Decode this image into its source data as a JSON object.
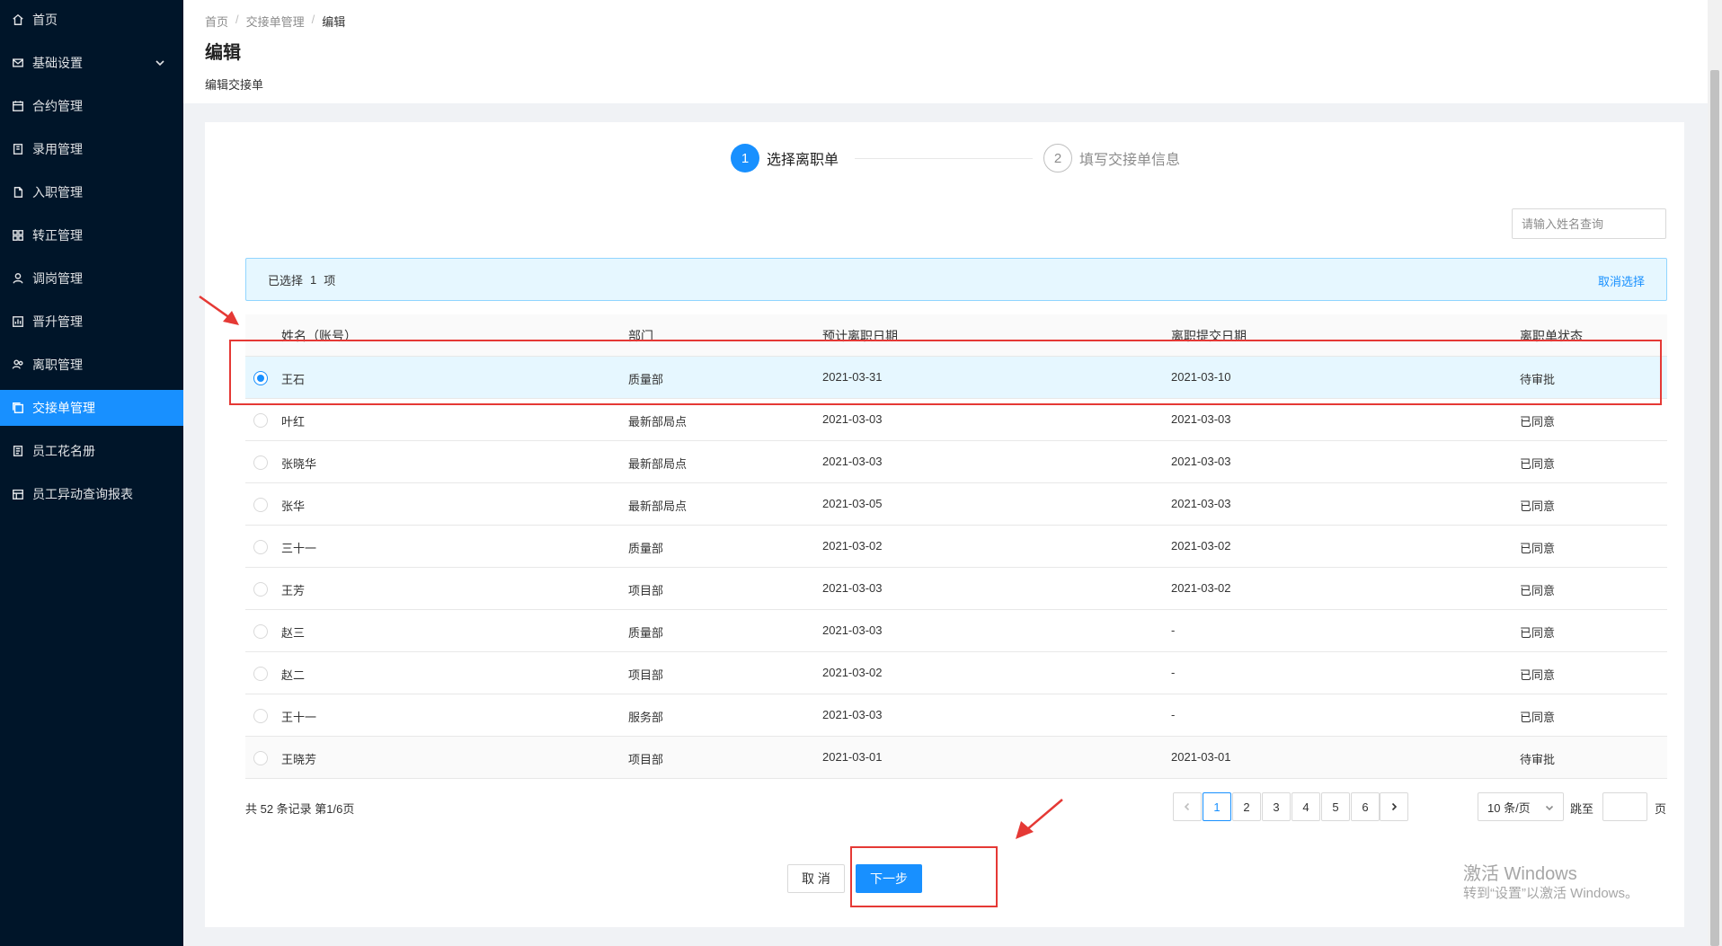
{
  "sidebar": {
    "items": [
      {
        "label": "首页",
        "icon": "home-icon"
      },
      {
        "label": "基础设置",
        "icon": "mail-icon",
        "expandable": true
      },
      {
        "label": "合约管理",
        "icon": "calendar-icon"
      },
      {
        "label": "录用管理",
        "icon": "book-icon"
      },
      {
        "label": "入职管理",
        "icon": "file-icon"
      },
      {
        "label": "转正管理",
        "icon": "grid-icon"
      },
      {
        "label": "调岗管理",
        "icon": "user-icon"
      },
      {
        "label": "晋升管理",
        "icon": "chart-icon"
      },
      {
        "label": "离职管理",
        "icon": "team-icon"
      },
      {
        "label": "交接单管理",
        "icon": "copy-icon",
        "active": true
      },
      {
        "label": "员工花名册",
        "icon": "list-icon"
      },
      {
        "label": "员工异动查询报表",
        "icon": "report-icon"
      }
    ]
  },
  "breadcrumb": {
    "home": "首页",
    "section": "交接单管理",
    "current": "编辑",
    "sep": "/"
  },
  "page": {
    "title": "编辑",
    "subtitle": "编辑交接单"
  },
  "steps": [
    {
      "num": "1",
      "label": "选择离职单",
      "status": "active"
    },
    {
      "num": "2",
      "label": "填写交接单信息",
      "status": "wait"
    }
  ],
  "search": {
    "placeholder": "请输入姓名查询",
    "value": ""
  },
  "alert": {
    "prefix": "已选择",
    "count": "1",
    "suffix": "项",
    "clear": "取消选择"
  },
  "table": {
    "columns": [
      "姓名（账号）",
      "部门",
      "预计离职日期",
      "离职提交日期",
      "离职单状态"
    ],
    "rows": [
      {
        "name": "王石",
        "dept": "质量部",
        "expected": "2021-03-31",
        "submitted": "2021-03-10",
        "status": "待审批",
        "selected": true
      },
      {
        "name": "叶红",
        "dept": "最新部局点",
        "expected": "2021-03-03",
        "submitted": "2021-03-03",
        "status": "已同意",
        "selected": false
      },
      {
        "name": "张晓华",
        "dept": "最新部局点",
        "expected": "2021-03-03",
        "submitted": "2021-03-03",
        "status": "已同意",
        "selected": false
      },
      {
        "name": "张华",
        "dept": "最新部局点",
        "expected": "2021-03-05",
        "submitted": "2021-03-03",
        "status": "已同意",
        "selected": false
      },
      {
        "name": "三十一",
        "dept": "质量部",
        "expected": "2021-03-02",
        "submitted": "2021-03-02",
        "status": "已同意",
        "selected": false
      },
      {
        "name": "王芳",
        "dept": "项目部",
        "expected": "2021-03-03",
        "submitted": "2021-03-02",
        "status": "已同意",
        "selected": false
      },
      {
        "name": "赵三",
        "dept": "质量部",
        "expected": "2021-03-03",
        "submitted": "-",
        "status": "已同意",
        "selected": false
      },
      {
        "name": "赵二",
        "dept": "项目部",
        "expected": "2021-03-02",
        "submitted": "-",
        "status": "已同意",
        "selected": false
      },
      {
        "name": "王十一",
        "dept": "服务部",
        "expected": "2021-03-03",
        "submitted": "-",
        "status": "已同意",
        "selected": false
      },
      {
        "name": "王晓芳",
        "dept": "项目部",
        "expected": "2021-03-01",
        "submitted": "2021-03-01",
        "status": "待审批",
        "selected": false
      }
    ]
  },
  "pagination": {
    "total_text": "共 52 条记录 第1/6页",
    "pages": [
      "1",
      "2",
      "3",
      "4",
      "5",
      "6"
    ],
    "current": "1",
    "page_size": "10 条/页",
    "jump_label": "跳至",
    "page_label": "页"
  },
  "actions": {
    "cancel": "取 消",
    "next": "下一步"
  },
  "watermark": {
    "line1": "激活 Windows",
    "line2": "转到“设置”以激活 Windows。"
  },
  "colors": {
    "primary": "#1890ff",
    "sidebar": "#001529",
    "annotation": "#e53935"
  }
}
